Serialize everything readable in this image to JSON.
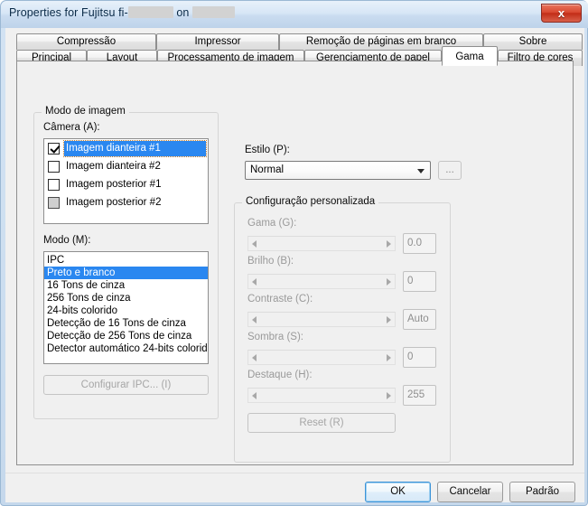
{
  "window": {
    "title_prefix": "Properties for Fujitsu fi-",
    "title_middle": " on ",
    "title_suffix": "",
    "close_label": "x",
    "accent_color": "#2a87f0",
    "close_color": "#c22d17"
  },
  "tabs": {
    "top_row": [
      {
        "label": "Compressão",
        "selected": false
      },
      {
        "label": "Impressor",
        "selected": false
      },
      {
        "label": "Remoção de páginas em branco",
        "selected": false
      },
      {
        "label": "Sobre",
        "selected": false
      }
    ],
    "bottom_row": [
      {
        "label": "Principal",
        "selected": false
      },
      {
        "label": "Layout",
        "selected": false
      },
      {
        "label": "Processamento de imagem",
        "selected": false
      },
      {
        "label": "Gerenciamento de papel",
        "selected": false
      },
      {
        "label": "Gama",
        "selected": true
      },
      {
        "label": "Filtro de cores",
        "selected": false
      }
    ]
  },
  "image_mode_group": {
    "title": "Modo de imagem",
    "camera_label": "Câmera (A):",
    "camera_items": [
      {
        "label": "Imagem dianteira #1",
        "checked": true,
        "selected": true,
        "disabled": false
      },
      {
        "label": "Imagem dianteira #2",
        "checked": false,
        "selected": false,
        "disabled": false
      },
      {
        "label": "Imagem posterior #1",
        "checked": false,
        "selected": false,
        "disabled": false
      },
      {
        "label": "Imagem posterior #2",
        "checked": false,
        "selected": false,
        "disabled": true
      }
    ],
    "mode_label": "Modo (M):",
    "mode_items": [
      {
        "label": "IPC",
        "selected": false
      },
      {
        "label": "Preto e branco",
        "selected": true
      },
      {
        "label": "16 Tons de cinza",
        "selected": false
      },
      {
        "label": "256 Tons de cinza",
        "selected": false
      },
      {
        "label": "24-bits colorido",
        "selected": false
      },
      {
        "label": "Detecção de 16 Tons de cinza",
        "selected": false
      },
      {
        "label": "Detecção de 256 Tons de cinza",
        "selected": false
      },
      {
        "label": "Detector automático 24-bits colorido",
        "selected": false
      }
    ],
    "configure_button": "Configurar IPC... (I)"
  },
  "style_section": {
    "label": "Estilo (P):",
    "selected_value": "Normal",
    "more_button": "..."
  },
  "custom_config_group": {
    "title": "Configuração personalizada",
    "sliders": [
      {
        "label": "Gama (G):",
        "value": "0.0"
      },
      {
        "label": "Brilho (B):",
        "value": "0"
      },
      {
        "label": "Contraste (C):",
        "value": "Auto"
      },
      {
        "label": "Sombra (S):",
        "value": "0"
      },
      {
        "label": "Destaque (H):",
        "value": "255"
      }
    ],
    "reset_button": "Reset (R)"
  },
  "footer": {
    "ok_label": "OK",
    "cancel_label": "Cancelar",
    "default_label": "Padrão"
  }
}
